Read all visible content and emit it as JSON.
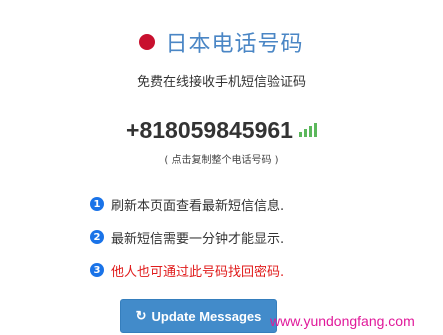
{
  "header": {
    "flag_icon": "japan-flag-icon",
    "flag_color": "#c8102e",
    "title": "日本电话号码",
    "title_color": "#4a86c5"
  },
  "subtitle": "免费在线接收手机短信验证码",
  "phone": {
    "number": "+818059845961",
    "signal_icon": "signal-bars-icon",
    "signal_color": "#5cb85c",
    "copy_hint": "( 点击复制整个电话号码 )"
  },
  "notes": [
    {
      "num": "1",
      "text": "刷新本页面查看最新短信信息."
    },
    {
      "num": "2",
      "text": "最新短信需要一分钟才能显示."
    },
    {
      "num": "3",
      "text": "他人也可通过此号码找回密码."
    }
  ],
  "note_colors": {
    "badge": "#1a73e8",
    "warning": "#e01b1b"
  },
  "update_button": {
    "icon": "refresh-icon",
    "label": "Update Messages",
    "color": "#428bca"
  },
  "watermark": "www.yundongfang.com"
}
